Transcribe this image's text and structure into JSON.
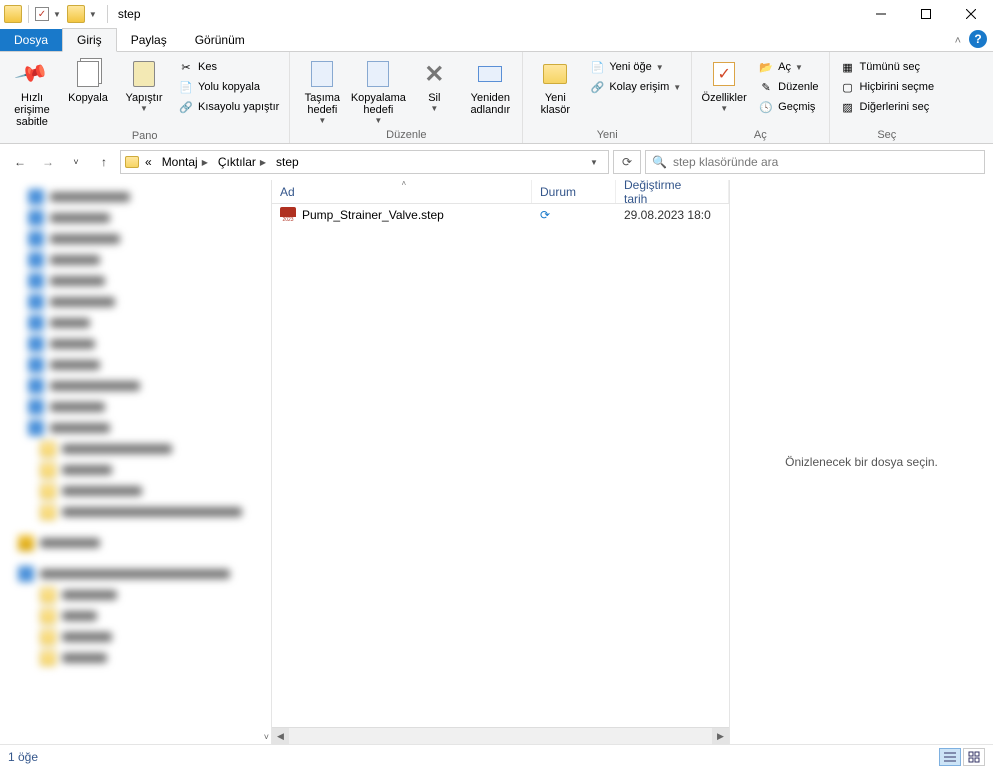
{
  "title": "step",
  "tabs": {
    "file": "Dosya",
    "home": "Giriş",
    "share": "Paylaş",
    "view": "Görünüm"
  },
  "ribbon": {
    "pin": "Hızlı erişime\nsabitle",
    "copy": "Kopyala",
    "paste": "Yapıştır",
    "cut": "Kes",
    "copypath": "Yolu kopyala",
    "pasteshortcut": "Kısayolu yapıştır",
    "clipboard_group": "Pano",
    "moveto": "Taşıma\nhedefi",
    "copyto": "Kopyalama\nhedefi",
    "delete": "Sil",
    "rename": "Yeniden\nadlandır",
    "organize_group": "Düzenle",
    "newfolder": "Yeni\nklasör",
    "newitem": "Yeni öğe",
    "easyaccess": "Kolay erişim",
    "new_group": "Yeni",
    "properties": "Özellikler",
    "open": "Aç",
    "edit": "Düzenle",
    "history": "Geçmiş",
    "open_group": "Aç",
    "selectall": "Tümünü seç",
    "selectnone": "Hiçbirini seçme",
    "invert": "Diğerlerini seç",
    "select_group": "Seç"
  },
  "breadcrumbs": [
    "Montaj",
    "Çıktılar",
    "step"
  ],
  "breadcrumb_prefix": "«",
  "search_placeholder": "step klasöründe ara",
  "columns": {
    "name": "Ad",
    "status": "Durum",
    "modified": "Değiştirme tarih"
  },
  "files": [
    {
      "name": "Pump_Strainer_Valve.step",
      "status_icon": "sync",
      "modified": "29.08.2023 18:0"
    }
  ],
  "preview_prompt": "Önizlenecek bir dosya seçin.",
  "status": {
    "count": "1 öğe"
  }
}
